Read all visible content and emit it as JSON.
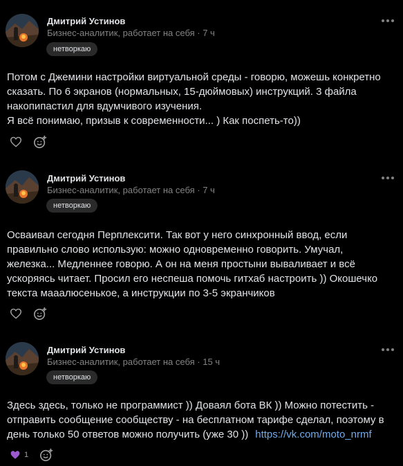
{
  "posts": [
    {
      "author": "Дмитрий Устинов",
      "subtitle": "Бизнес-аналитик, работает на себя · 7 ч",
      "tag": "нетворкаю",
      "lines": [
        "Потом с Джемини настройки виртуальной среды - говорю, можешь конкретно",
        "сказать. По 6 экранов (нормальных, 15-дюймовых) инструкций. 3 файла",
        "накопипастил для вдумчивого изучения.",
        "Я всё понимаю, призыв к современности... ) Как поспеть-то))"
      ],
      "like_icon": "heart-outline-icon",
      "reaction_icon": "add-reaction-icon"
    },
    {
      "author": "Дмитрий Устинов",
      "subtitle": "Бизнес-аналитик, работает на себя · 7 ч",
      "tag": "нетворкаю",
      "lines": [
        "Осваивал сегодня Перплексити. Так вот у него синхронный ввод, если",
        "правильно слово использую: можно одновременно говорить. Умучал,",
        "железка... Медленнее говорю. А он на меня простыни вываливает и всё",
        "ускоряясь читает. Просил его неспеша помочь гитхаб настроить )) Окошечко",
        "текста маaaлюсенькое, а инструкции по 3-5 экранчиков"
      ],
      "like_icon": "heart-outline-icon",
      "reaction_icon": "add-reaction-icon"
    },
    {
      "author": "Дмитрий Устинов",
      "subtitle": "Бизнес-аналитик, работает на себя · 15 ч",
      "tag": "нетворкаю",
      "lines": [
        "Здесь здесь, только не программист )) Доваял бота ВК )) Можно потестить -",
        "отправить сообщение сообществу - на бесплатном тарифе сделал, поэтому в",
        "день только 50 ответов можно получить (уже 30 ))"
      ],
      "link": "https://vk.com/moto_nrmf",
      "like_icon": "purple-heart-icon",
      "like_count": "1",
      "reaction_icon": "add-reaction-icon"
    }
  ],
  "colors": {
    "background": "#000000",
    "text": "#e1e3e6",
    "secondary": "#828282",
    "link": "#71aaeb",
    "tag_bg": "#2a2a2a",
    "purple_heart": "#9b59d0"
  }
}
